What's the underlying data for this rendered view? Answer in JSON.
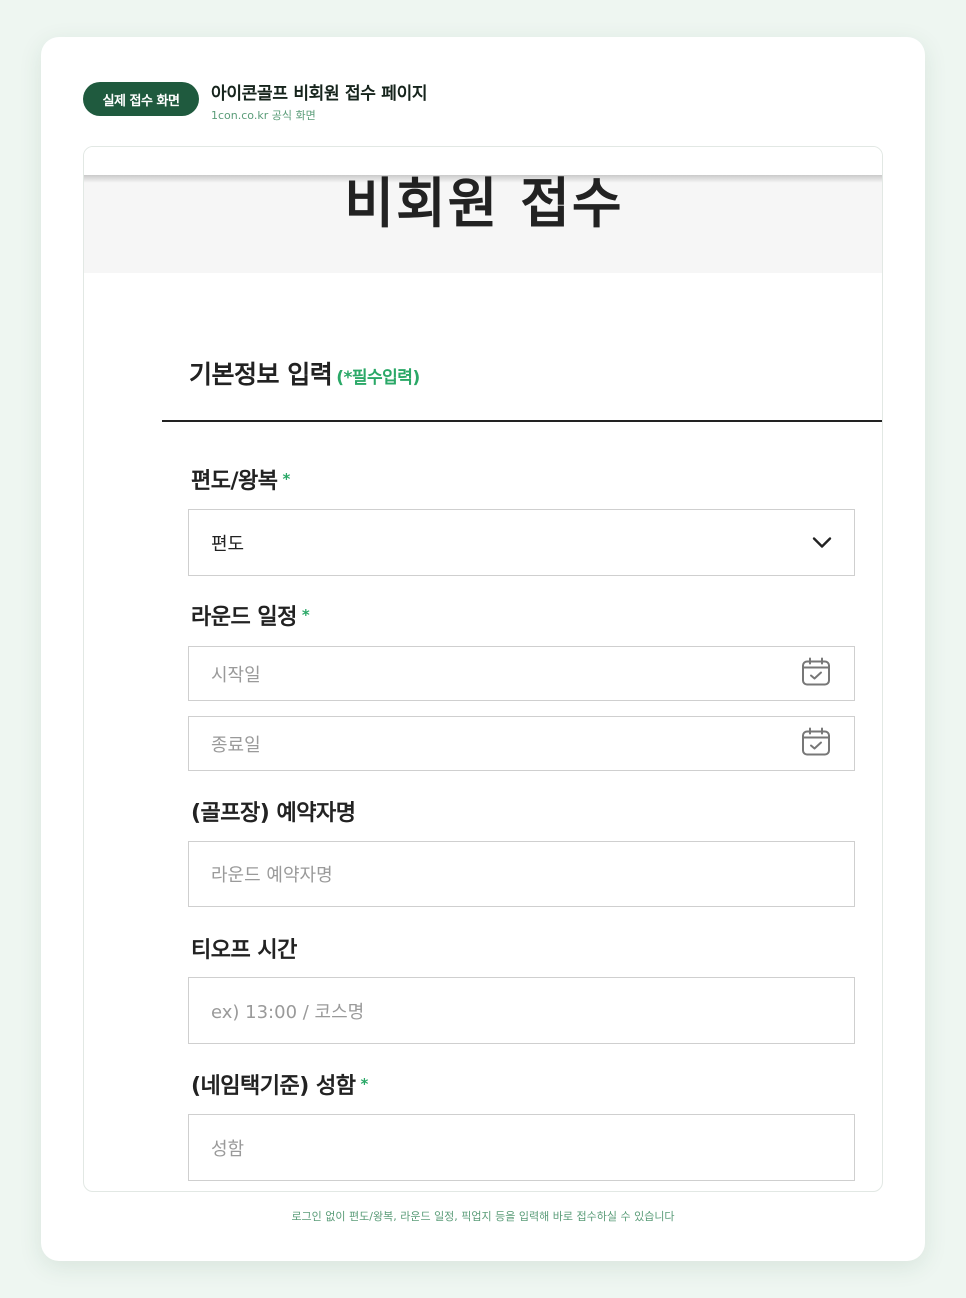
{
  "header": {
    "badge": "실제 접수 화면",
    "title": "아이콘골프 비회원 접수 페이지",
    "subtitle": "1con.co.kr 공식 화면"
  },
  "form": {
    "hero_title": "비회원 접수",
    "section_title": "기본정보 입력",
    "section_required_note": "(*필수입력)",
    "required_mark": "*",
    "trip_type": {
      "label": "편도/왕복",
      "value": "편도",
      "icon": "chevron-down-icon"
    },
    "round_schedule": {
      "label": "라운드 일정",
      "start_placeholder": "시작일",
      "end_placeholder": "종료일",
      "icon": "calendar-check-icon"
    },
    "booker_name": {
      "label": "(골프장) 예약자명",
      "placeholder": "라운드 예약자명"
    },
    "tee_off_time": {
      "label": "티오프 시간",
      "placeholder": "ex) 13:00 / 코스명"
    },
    "full_name": {
      "label": "(네임택기준) 성함",
      "placeholder": "성함"
    }
  },
  "footer": {
    "note": "로그인 없이 편도/왕복, 라운드 일정, 픽업지 등을 입력해 바로 접수하실 수 있습니다"
  },
  "colors": {
    "accent_green": "#2aa867",
    "badge_green": "#1f5a3e",
    "page_bg": "#eef6f1"
  }
}
